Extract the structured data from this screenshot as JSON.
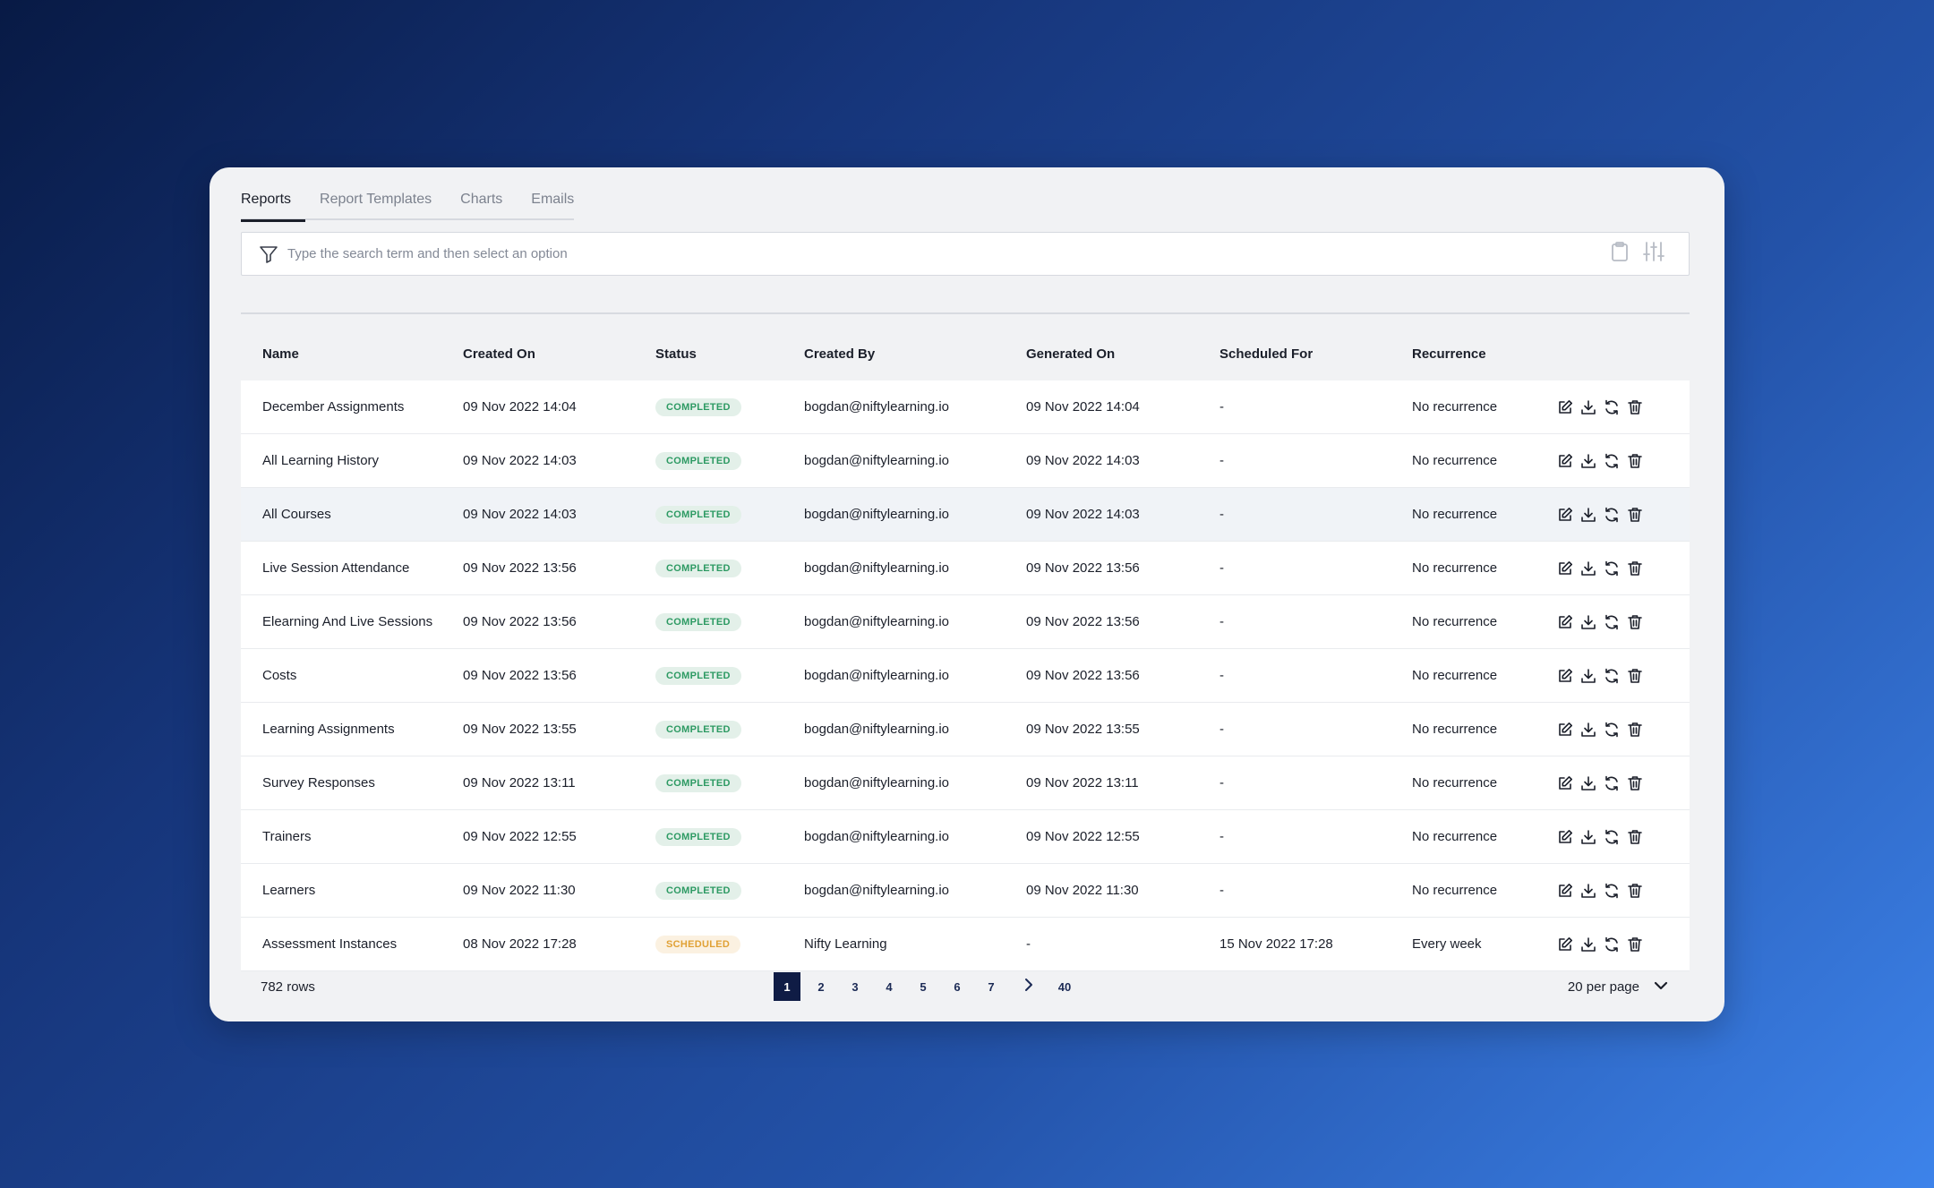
{
  "tabs": [
    {
      "label": "Reports",
      "active": true
    },
    {
      "label": "Report Templates",
      "active": false
    },
    {
      "label": "Charts",
      "active": false
    },
    {
      "label": "Emails",
      "active": false
    }
  ],
  "search": {
    "placeholder": "Type the search term and then select an option",
    "value": "",
    "left_icon": "filter-icon",
    "right_icons": [
      "clipboard-icon",
      "sliders-icon"
    ]
  },
  "columns": [
    "Name",
    "Created On",
    "Status",
    "Created By",
    "Generated On",
    "Scheduled For",
    "Recurrence"
  ],
  "rows": [
    {
      "name": "December Assignments",
      "created_on": "09 Nov 2022 14:04",
      "status": "COMPLETED",
      "created_by": "bogdan@niftylearning.io",
      "generated_on": "09 Nov 2022 14:04",
      "scheduled_for": "-",
      "recurrence": "No recurrence"
    },
    {
      "name": "All Learning History",
      "created_on": "09 Nov 2022 14:03",
      "status": "COMPLETED",
      "created_by": "bogdan@niftylearning.io",
      "generated_on": "09 Nov 2022 14:03",
      "scheduled_for": "-",
      "recurrence": "No recurrence"
    },
    {
      "name": "All Courses",
      "created_on": "09 Nov 2022 14:03",
      "status": "COMPLETED",
      "created_by": "bogdan@niftylearning.io",
      "generated_on": "09 Nov 2022 14:03",
      "scheduled_for": "-",
      "recurrence": "No recurrence"
    },
    {
      "name": "Live Session Attendance",
      "created_on": "09 Nov 2022 13:56",
      "status": "COMPLETED",
      "created_by": "bogdan@niftylearning.io",
      "generated_on": "09 Nov 2022 13:56",
      "scheduled_for": "-",
      "recurrence": "No recurrence"
    },
    {
      "name": "Elearning And Live Sessions",
      "created_on": "09 Nov 2022 13:56",
      "status": "COMPLETED",
      "created_by": "bogdan@niftylearning.io",
      "generated_on": "09 Nov 2022 13:56",
      "scheduled_for": "-",
      "recurrence": "No recurrence"
    },
    {
      "name": "Costs",
      "created_on": "09 Nov 2022 13:56",
      "status": "COMPLETED",
      "created_by": "bogdan@niftylearning.io",
      "generated_on": "09 Nov 2022 13:56",
      "scheduled_for": "-",
      "recurrence": "No recurrence"
    },
    {
      "name": "Learning Assignments",
      "created_on": "09 Nov 2022 13:55",
      "status": "COMPLETED",
      "created_by": "bogdan@niftylearning.io",
      "generated_on": "09 Nov 2022 13:55",
      "scheduled_for": "-",
      "recurrence": "No recurrence"
    },
    {
      "name": "Survey Responses",
      "created_on": "09 Nov 2022 13:11",
      "status": "COMPLETED",
      "created_by": "bogdan@niftylearning.io",
      "generated_on": "09 Nov 2022 13:11",
      "scheduled_for": "-",
      "recurrence": "No recurrence"
    },
    {
      "name": "Trainers",
      "created_on": "09 Nov 2022 12:55",
      "status": "COMPLETED",
      "created_by": "bogdan@niftylearning.io",
      "generated_on": "09 Nov 2022 12:55",
      "scheduled_for": "-",
      "recurrence": "No recurrence"
    },
    {
      "name": "Learners",
      "created_on": "09 Nov 2022 11:30",
      "status": "COMPLETED",
      "created_by": "bogdan@niftylearning.io",
      "generated_on": "09 Nov 2022 11:30",
      "scheduled_for": "-",
      "recurrence": "No recurrence"
    },
    {
      "name": "Assessment Instances",
      "created_on": "08 Nov 2022 17:28",
      "status": "SCHEDULED",
      "created_by": "Nifty Learning",
      "generated_on": "-",
      "scheduled_for": "15 Nov 2022 17:28",
      "recurrence": "Every week"
    }
  ],
  "row_actions": [
    "edit-icon",
    "download-icon",
    "refresh-icon",
    "delete-icon"
  ],
  "footer": {
    "rows_count": "782 rows",
    "pages": [
      "1",
      "2",
      "3",
      "4",
      "5",
      "6",
      "7"
    ],
    "current_page": "1",
    "last_page": "40",
    "per_page": "20 per page"
  },
  "colors": {
    "completed_text": "#2d9a63",
    "completed_bg": "#e3f0e9",
    "scheduled_text": "#e0a135",
    "scheduled_bg": "#fbf1e1",
    "pager_active": "#0f1c45"
  }
}
